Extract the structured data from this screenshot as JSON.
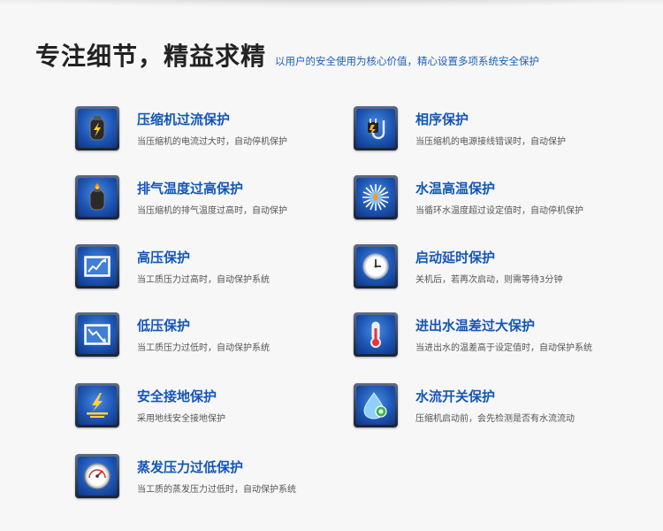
{
  "header": {
    "title": "专注细节，精益求精",
    "subtitle": "以用户的安全使用为核心价值，精心设置多项系统安全保护"
  },
  "features": [
    {
      "title": "压缩机过流保护",
      "desc": "当压缩机的电流过大时，自动停机保护",
      "icon": "compressor-lightning-icon"
    },
    {
      "title": "相序保护",
      "desc": "当压缩机的电源接线错误时，自动保护",
      "icon": "power-plug-icon"
    },
    {
      "title": "排气温度过高保护",
      "desc": "当压缩机的排气温度过高时，自动保护",
      "icon": "flame-cylinder-icon"
    },
    {
      "title": "水温高温保护",
      "desc": "当循环水温度超过设定值时，自动停机保护",
      "icon": "sunburst-icon"
    },
    {
      "title": "高压保护",
      "desc": "当工质压力过高时，自动保护系统",
      "icon": "chart-rising-icon"
    },
    {
      "title": "启动延时保护",
      "desc": "关机后，若再次启动，则需等待3分钟",
      "icon": "clock-icon"
    },
    {
      "title": "低压保护",
      "desc": "当工质压力过低时，自动保护系统",
      "icon": "chart-falling-icon"
    },
    {
      "title": "进出水温差过大保护",
      "desc": "当进出水的温差高于设定值时，自动保护系统",
      "icon": "thermometer-icon"
    },
    {
      "title": "安全接地保护",
      "desc": "采用地线安全接地保护",
      "icon": "ground-lightning-icon"
    },
    {
      "title": "水流开关保护",
      "desc": "压缩机启动前，会先检测是否有水流流动",
      "icon": "water-drop-icon"
    },
    {
      "title": "蒸发压力过低保护",
      "desc": "当工质的蒸发压力过低时，自动保护系统",
      "icon": "pressure-gauge-icon"
    }
  ]
}
